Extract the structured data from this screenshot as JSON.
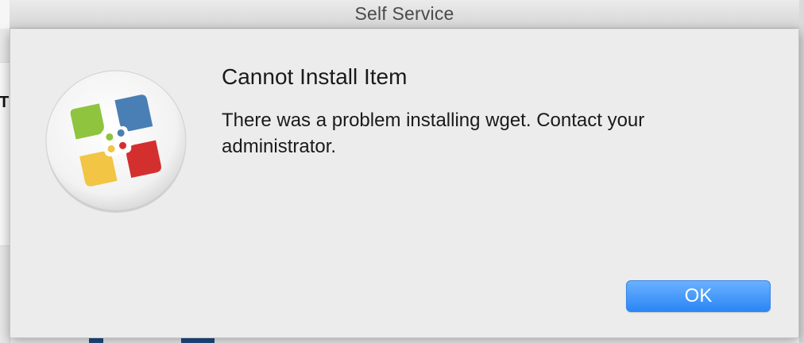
{
  "window": {
    "title": "Self Service"
  },
  "background_app": {
    "partial_text": "T"
  },
  "alert": {
    "title": "Cannot Install Item",
    "message": "There was a problem installing wget. Contact your administrator.",
    "ok_label": "OK",
    "icon": "self-service-app-icon"
  },
  "colors": {
    "accent_button": "#2a86f5",
    "icon_green": "#8fc43f",
    "icon_blue": "#4a7fb5",
    "icon_yellow": "#f2c544",
    "icon_red": "#d42f2f"
  }
}
